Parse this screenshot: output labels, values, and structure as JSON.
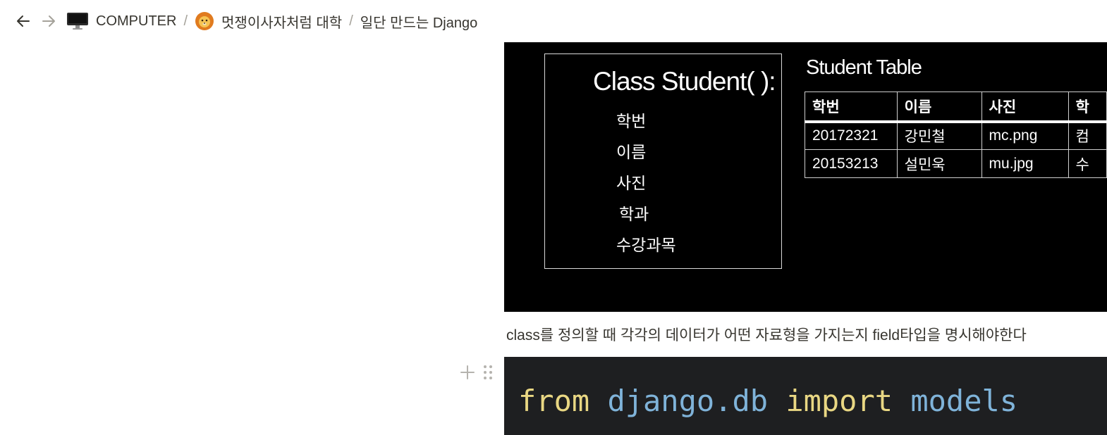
{
  "breadcrumb": {
    "items": [
      {
        "icon": "computer-icon",
        "label": "COMPUTER"
      },
      {
        "icon": "lion-icon",
        "label": "멋쟁이사자처럼 대학"
      },
      {
        "label": "일단 만드는 Django"
      }
    ],
    "separator": "/"
  },
  "slide": {
    "class_title": "Class Student( ):",
    "fields": [
      "학번",
      "이름",
      "사진",
      "학과",
      "수강과목"
    ],
    "table_title": "Student Table",
    "table": {
      "headers": [
        "학번",
        "이름",
        "사진",
        "학"
      ],
      "rows": [
        [
          "20172321",
          "강민철",
          "mc.png",
          "컴"
        ],
        [
          "20153213",
          "설민욱",
          "mu.jpg",
          "수"
        ]
      ]
    }
  },
  "paragraph": "class를 정의할 때 각각의 데이터가 어떤 자료형을 가지는지  field타입을 명시해야한다",
  "code": {
    "keyword_from": "from",
    "module": "django.db",
    "keyword_import": "import",
    "name": "models"
  },
  "colors": {
    "text": "#37352f",
    "code_bg": "#1e1f21",
    "keyword": "#e9d783",
    "module": "#7fb3d9"
  }
}
